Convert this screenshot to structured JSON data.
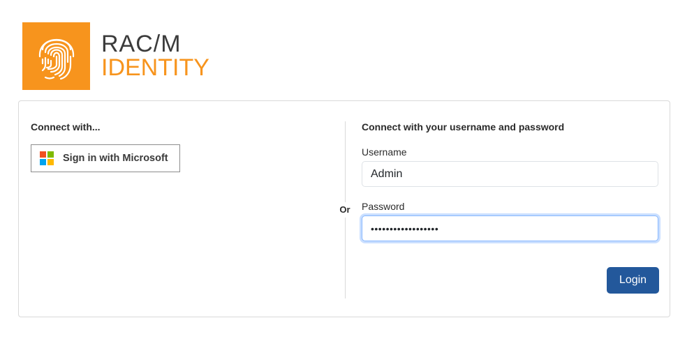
{
  "logo": {
    "line1": "RAC/M",
    "line2": "IDENTITY",
    "icon": "fingerprint-icon",
    "brand_color": "#f7941d"
  },
  "left": {
    "title": "Connect with...",
    "microsoft_button": {
      "label": "Sign in with Microsoft",
      "icon": "microsoft-logo-icon",
      "colors": [
        "#f25022",
        "#7fba00",
        "#00a4ef",
        "#ffb900"
      ]
    }
  },
  "separator": {
    "label": "Or"
  },
  "right": {
    "title": "Connect with your username and password",
    "username": {
      "label": "Username",
      "value": "Admin"
    },
    "password": {
      "label": "Password",
      "value": "••••••••••••••••••"
    },
    "login_label": "Login",
    "button_color": "#23589b"
  }
}
